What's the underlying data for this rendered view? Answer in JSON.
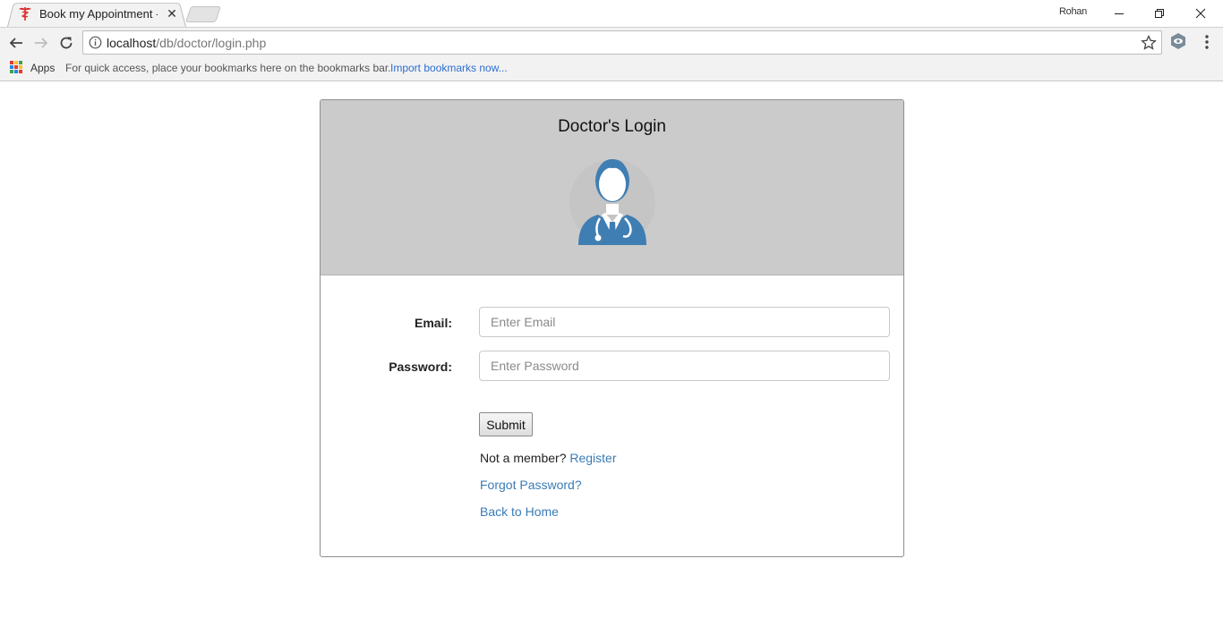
{
  "browser": {
    "tab_title": "Book my Appointment -",
    "tab_close": "✕",
    "profile_name": "Rohan",
    "url_host": "localhost",
    "url_path": "/db/doctor/login.php",
    "bookmarks": {
      "apps_label": "Apps",
      "hint": "For quick access, place your bookmarks here on the bookmarks bar.",
      "import_link": "Import bookmarks now..."
    },
    "colors": {
      "chrome_bg": "#f2f2f2",
      "link": "#2d6ed1"
    }
  },
  "page": {
    "title": "Doctor's Login",
    "avatar_icon": "doctor-icon",
    "form": {
      "email_label": "Email:",
      "email_placeholder": "Enter Email",
      "email_value": "",
      "password_label": "Password:",
      "password_placeholder": "Enter Password",
      "password_value": "",
      "submit_label": "Submit"
    },
    "not_member_text": "Not a member?",
    "register_link": "Register",
    "forgot_link": "Forgot Password?",
    "home_link": "Back to Home",
    "colors": {
      "header_bg": "#cbcbcb",
      "accent": "#3f7eb3",
      "link": "#3a7bb5"
    }
  }
}
